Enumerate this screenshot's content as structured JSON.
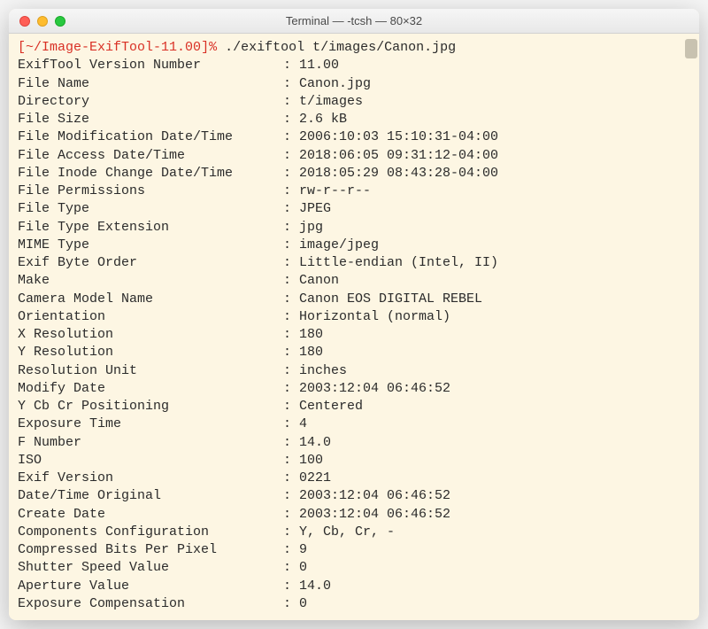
{
  "window": {
    "title": "Terminal — -tcsh — 80×32"
  },
  "prompt": {
    "open_bracket": "[",
    "path": "~/Image-ExifTool-11.00",
    "close_bracket": "]",
    "symbol": "%",
    "command": "./exiftool t/images/Canon.jpg"
  },
  "output": [
    {
      "key": "ExifTool Version Number",
      "value": "11.00"
    },
    {
      "key": "File Name",
      "value": "Canon.jpg"
    },
    {
      "key": "Directory",
      "value": "t/images"
    },
    {
      "key": "File Size",
      "value": "2.6 kB"
    },
    {
      "key": "File Modification Date/Time",
      "value": "2006:10:03 15:10:31-04:00"
    },
    {
      "key": "File Access Date/Time",
      "value": "2018:06:05 09:31:12-04:00"
    },
    {
      "key": "File Inode Change Date/Time",
      "value": "2018:05:29 08:43:28-04:00"
    },
    {
      "key": "File Permissions",
      "value": "rw-r--r--"
    },
    {
      "key": "File Type",
      "value": "JPEG"
    },
    {
      "key": "File Type Extension",
      "value": "jpg"
    },
    {
      "key": "MIME Type",
      "value": "image/jpeg"
    },
    {
      "key": "Exif Byte Order",
      "value": "Little-endian (Intel, II)"
    },
    {
      "key": "Make",
      "value": "Canon"
    },
    {
      "key": "Camera Model Name",
      "value": "Canon EOS DIGITAL REBEL"
    },
    {
      "key": "Orientation",
      "value": "Horizontal (normal)"
    },
    {
      "key": "X Resolution",
      "value": "180"
    },
    {
      "key": "Y Resolution",
      "value": "180"
    },
    {
      "key": "Resolution Unit",
      "value": "inches"
    },
    {
      "key": "Modify Date",
      "value": "2003:12:04 06:46:52"
    },
    {
      "key": "Y Cb Cr Positioning",
      "value": "Centered"
    },
    {
      "key": "Exposure Time",
      "value": "4"
    },
    {
      "key": "F Number",
      "value": "14.0"
    },
    {
      "key": "ISO",
      "value": "100"
    },
    {
      "key": "Exif Version",
      "value": "0221"
    },
    {
      "key": "Date/Time Original",
      "value": "2003:12:04 06:46:52"
    },
    {
      "key": "Create Date",
      "value": "2003:12:04 06:46:52"
    },
    {
      "key": "Components Configuration",
      "value": "Y, Cb, Cr, -"
    },
    {
      "key": "Compressed Bits Per Pixel",
      "value": "9"
    },
    {
      "key": "Shutter Speed Value",
      "value": "0"
    },
    {
      "key": "Aperture Value",
      "value": "14.0"
    },
    {
      "key": "Exposure Compensation",
      "value": "0"
    }
  ]
}
